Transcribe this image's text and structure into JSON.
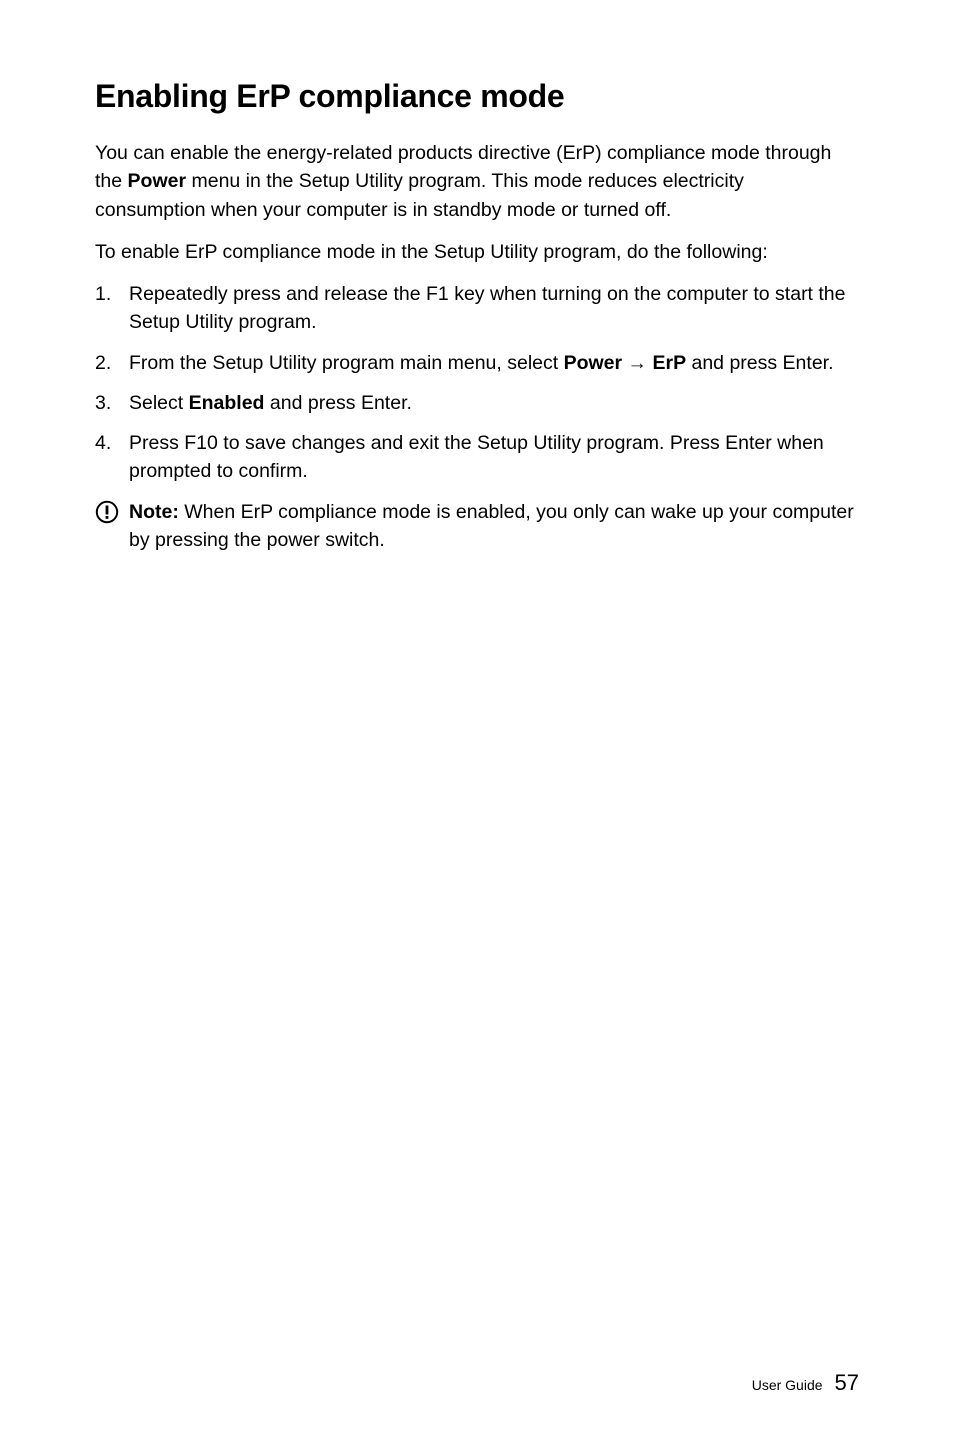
{
  "heading": "Enabling ErP compliance mode",
  "para1_part1": "You can enable the energy-related products directive (ErP) compliance mode through the ",
  "para1_bold1": "Power",
  "para1_part2": " menu in the Setup Utility program. This mode reduces electricity consumption when your computer is in standby mode or turned off.",
  "para2": "To enable ErP compliance mode in the Setup Utility program, do the following:",
  "list": {
    "item1": {
      "marker": "1.",
      "text": "Repeatedly press and release the F1 key when turning on the computer to start the Setup Utility program."
    },
    "item2": {
      "marker": "2.",
      "text_part1": "From the Setup Utility program main menu, select ",
      "bold1": "Power",
      "arrow": " → ",
      "bold2": "ErP",
      "text_part2": " and press Enter."
    },
    "item3": {
      "marker": "3.",
      "text_part1": "Select ",
      "bold1": "Enabled",
      "text_part2": " and press Enter."
    },
    "item4": {
      "marker": "4.",
      "text": "Press F10 to save changes and exit the Setup Utility program. Press Enter when prompted to confirm."
    }
  },
  "note": {
    "label": "Note:",
    "text": " When ErP compliance mode is enabled, you only can wake up your computer by pressing the power switch."
  },
  "footer": {
    "label": "User Guide",
    "page": "57"
  }
}
